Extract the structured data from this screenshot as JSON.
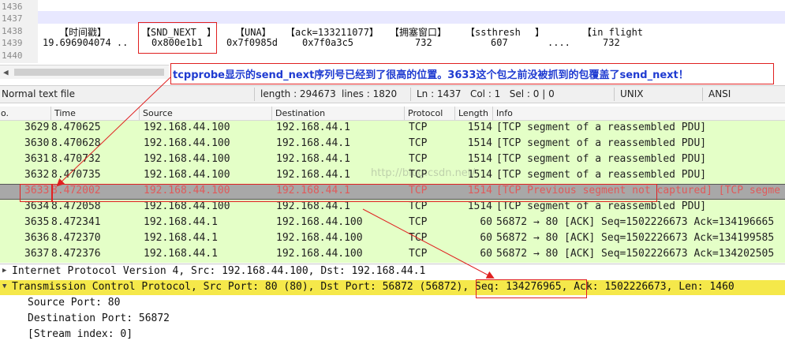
{
  "editor": {
    "line_numbers": [
      "1436",
      "1437",
      "1438",
      "1439",
      "1440"
    ],
    "header_row": {
      "time": "【时间戳】",
      "snd_next": "【SND_NEXT",
      "snd_next_close": "】",
      "una": "【UNA】",
      "ack": "【ack=133211077】",
      "cwnd": "【拥塞窗口】",
      "ssthresh": "【ssthresh",
      "ssthresh_close": "】",
      "inflight": "【in flight"
    },
    "value_row": {
      "time": "19.696904074 ..",
      "snd_next": "0x800e1b1",
      "una": "0x7f0985d",
      "ack": "0x7f0a3c5",
      "cwnd": "732",
      "ssthresh": "607",
      "dots": "....",
      "inflight": "732"
    }
  },
  "annotation": "tcpprobe显示的send_next序列号已经到了很高的位置。3633这个包之前没被抓到的包覆盖了send_next！",
  "statusbar": {
    "file_type": "Normal text file",
    "length": "length : 294673",
    "lines": "lines : 1820",
    "position": "Ln : 1437   Col : 1   Sel : 0 | 0",
    "eol": "UNIX",
    "encoding": "ANSI"
  },
  "packet_list": {
    "columns": [
      "o.",
      "Time",
      "Source",
      "Destination",
      "Protocol",
      "Length",
      "Info"
    ],
    "rows": [
      {
        "no": "3629",
        "time": "8.470625",
        "src": "192.168.44.100",
        "dst": "192.168.44.1",
        "proto": "TCP",
        "len": "1514",
        "info": "[TCP segment of a reassembled PDU]"
      },
      {
        "no": "3630",
        "time": "8.470628",
        "src": "192.168.44.100",
        "dst": "192.168.44.1",
        "proto": "TCP",
        "len": "1514",
        "info": "[TCP segment of a reassembled PDU]"
      },
      {
        "no": "3631",
        "time": "8.470732",
        "src": "192.168.44.100",
        "dst": "192.168.44.1",
        "proto": "TCP",
        "len": "1514",
        "info": "[TCP segment of a reassembled PDU]"
      },
      {
        "no": "3632",
        "time": "8.470735",
        "src": "192.168.44.100",
        "dst": "192.168.44.1",
        "proto": "TCP",
        "len": "1514",
        "info": "[TCP segment of a reassembled PDU]"
      },
      {
        "no": "3633",
        "time": "8.472002",
        "src": "192.168.44.100",
        "dst": "192.168.44.1",
        "proto": "TCP",
        "len": "1514",
        "info": "[TCP Previous segment not captured] [TCP segme"
      },
      {
        "no": "3634",
        "time": "8.472058",
        "src": "192.168.44.100",
        "dst": "192.168.44.1",
        "proto": "TCP",
        "len": "1514",
        "info": "[TCP segment of a reassembled PDU]"
      },
      {
        "no": "3635",
        "time": "8.472341",
        "src": "192.168.44.1",
        "dst": "192.168.44.100",
        "proto": "TCP",
        "len": "60",
        "info": "56872 → 80 [ACK] Seq=1502226673 Ack=134196665"
      },
      {
        "no": "3636",
        "time": "8.472370",
        "src": "192.168.44.1",
        "dst": "192.168.44.100",
        "proto": "TCP",
        "len": "60",
        "info": "56872 → 80 [ACK] Seq=1502226673 Ack=134199585"
      },
      {
        "no": "3637",
        "time": "8.472376",
        "src": "192.168.44.1",
        "dst": "192.168.44.100",
        "proto": "TCP",
        "len": "60",
        "info": "56872 → 80 [ACK] Seq=1502226673 Ack=134202505"
      }
    ]
  },
  "details": {
    "ip": "Internet Protocol Version 4, Src: 192.168.44.100, Dst: 192.168.44.1",
    "tcp_pre": "Transmission Control Protocol, Src Port: 80 (80), Dst Port: 56872 (56872), ",
    "tcp_seq": "Seq: 134276965,",
    "tcp_post": " Ack: 1502226673, Len: 1460",
    "src_port": "Source Port: 80",
    "dst_port": "Destination Port: 56872",
    "stream": "[Stream index: 0]"
  },
  "watermark": "http://blog.csdn.net/",
  "colors": {
    "row_green": "#e4ffc7",
    "row_selected": "#a8a8a8",
    "detail_highlight": "#f5e84a",
    "annotation_blue": "#1f3bd1",
    "annotation_red": "#e02020"
  }
}
